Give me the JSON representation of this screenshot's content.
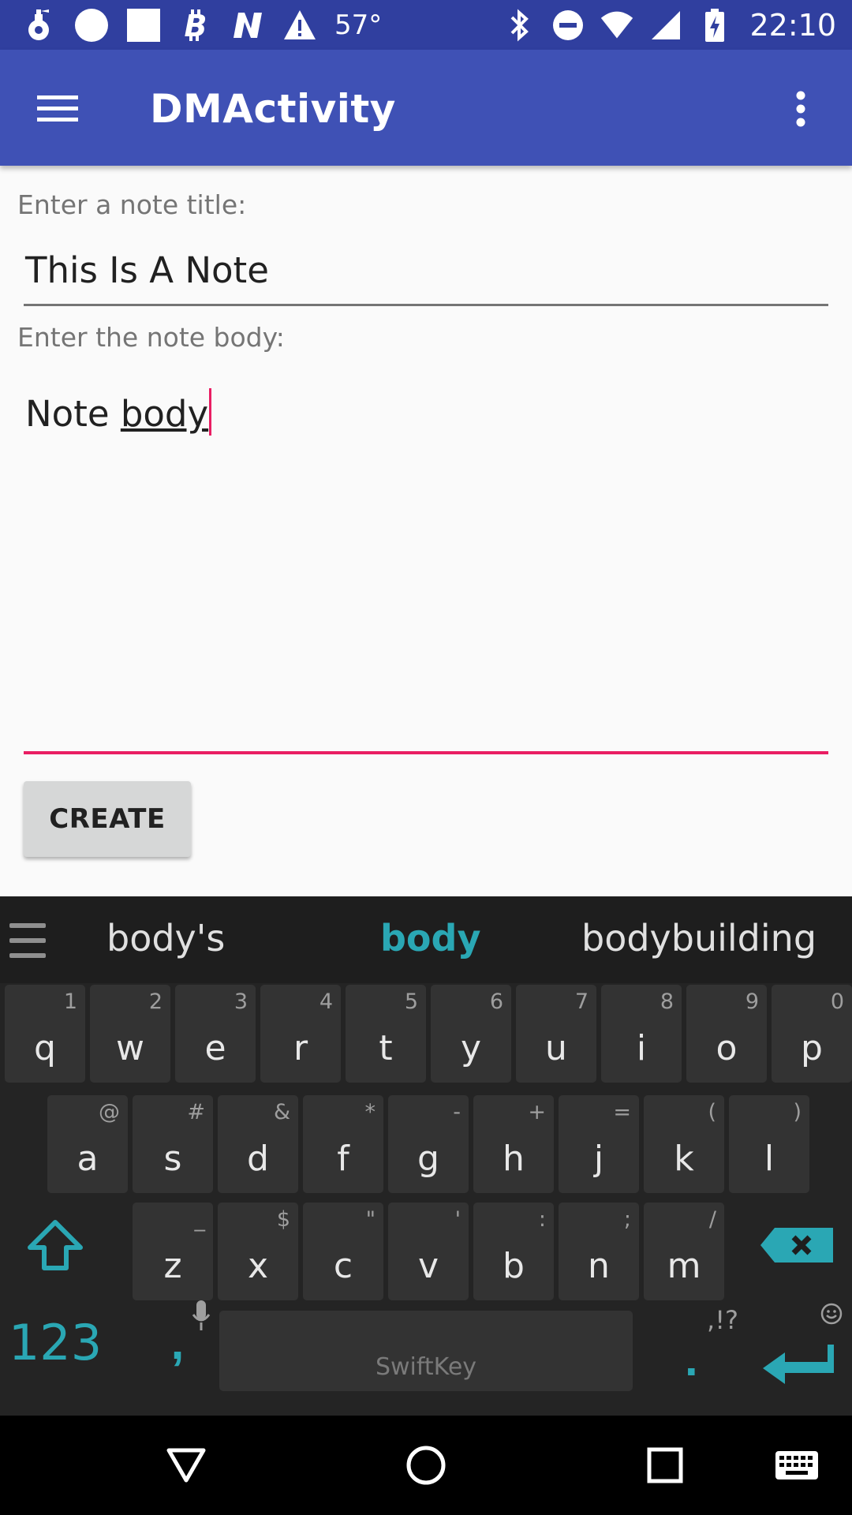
{
  "status_bar": {
    "temperature": "57°",
    "time": "22:10",
    "icons_left": [
      "fire-extinguisher-icon",
      "circle-icon",
      "square-icon",
      "bitcoin-icon",
      "n-logo-icon",
      "warning-icon"
    ],
    "icons_right": [
      "bluetooth-icon",
      "do-not-disturb-icon",
      "wifi-icon",
      "signal-icon",
      "battery-charging-icon"
    ]
  },
  "app_bar": {
    "title": "DMActivity"
  },
  "form": {
    "title_label": "Enter a note title:",
    "title_value": "This Is A Note",
    "body_label": "Enter the note body:",
    "body_value_plain": "Note ",
    "body_value_composing": "body",
    "create_label": "CREATE"
  },
  "keyboard": {
    "suggestions": [
      "body's",
      "body",
      "bodybuilding"
    ],
    "row1": [
      {
        "key": "q",
        "hint": "1"
      },
      {
        "key": "w",
        "hint": "2"
      },
      {
        "key": "e",
        "hint": "3"
      },
      {
        "key": "r",
        "hint": "4"
      },
      {
        "key": "t",
        "hint": "5"
      },
      {
        "key": "y",
        "hint": "6"
      },
      {
        "key": "u",
        "hint": "7"
      },
      {
        "key": "i",
        "hint": "8"
      },
      {
        "key": "o",
        "hint": "9"
      },
      {
        "key": "p",
        "hint": "0"
      }
    ],
    "row2": [
      {
        "key": "a",
        "hint": "@"
      },
      {
        "key": "s",
        "hint": "#"
      },
      {
        "key": "d",
        "hint": "&"
      },
      {
        "key": "f",
        "hint": "*"
      },
      {
        "key": "g",
        "hint": "-"
      },
      {
        "key": "h",
        "hint": "+"
      },
      {
        "key": "j",
        "hint": "="
      },
      {
        "key": "k",
        "hint": "("
      },
      {
        "key": "l",
        "hint": ")"
      }
    ],
    "row3": [
      {
        "key": "z",
        "hint": "_"
      },
      {
        "key": "x",
        "hint": "$"
      },
      {
        "key": "c",
        "hint": "\""
      },
      {
        "key": "v",
        "hint": "'"
      },
      {
        "key": "b",
        "hint": ":"
      },
      {
        "key": "n",
        "hint": ";"
      },
      {
        "key": "m",
        "hint": "/"
      }
    ],
    "numbers_label": "123",
    "comma_label": ",",
    "space_label": "SwiftKey",
    "period_label": ".",
    "period_hint": ",!?"
  },
  "colors": {
    "primary": "#3F51B5",
    "primary_dark": "#303F9F",
    "accent": "#E91E63",
    "keyboard_accent": "#2AA7B4"
  }
}
